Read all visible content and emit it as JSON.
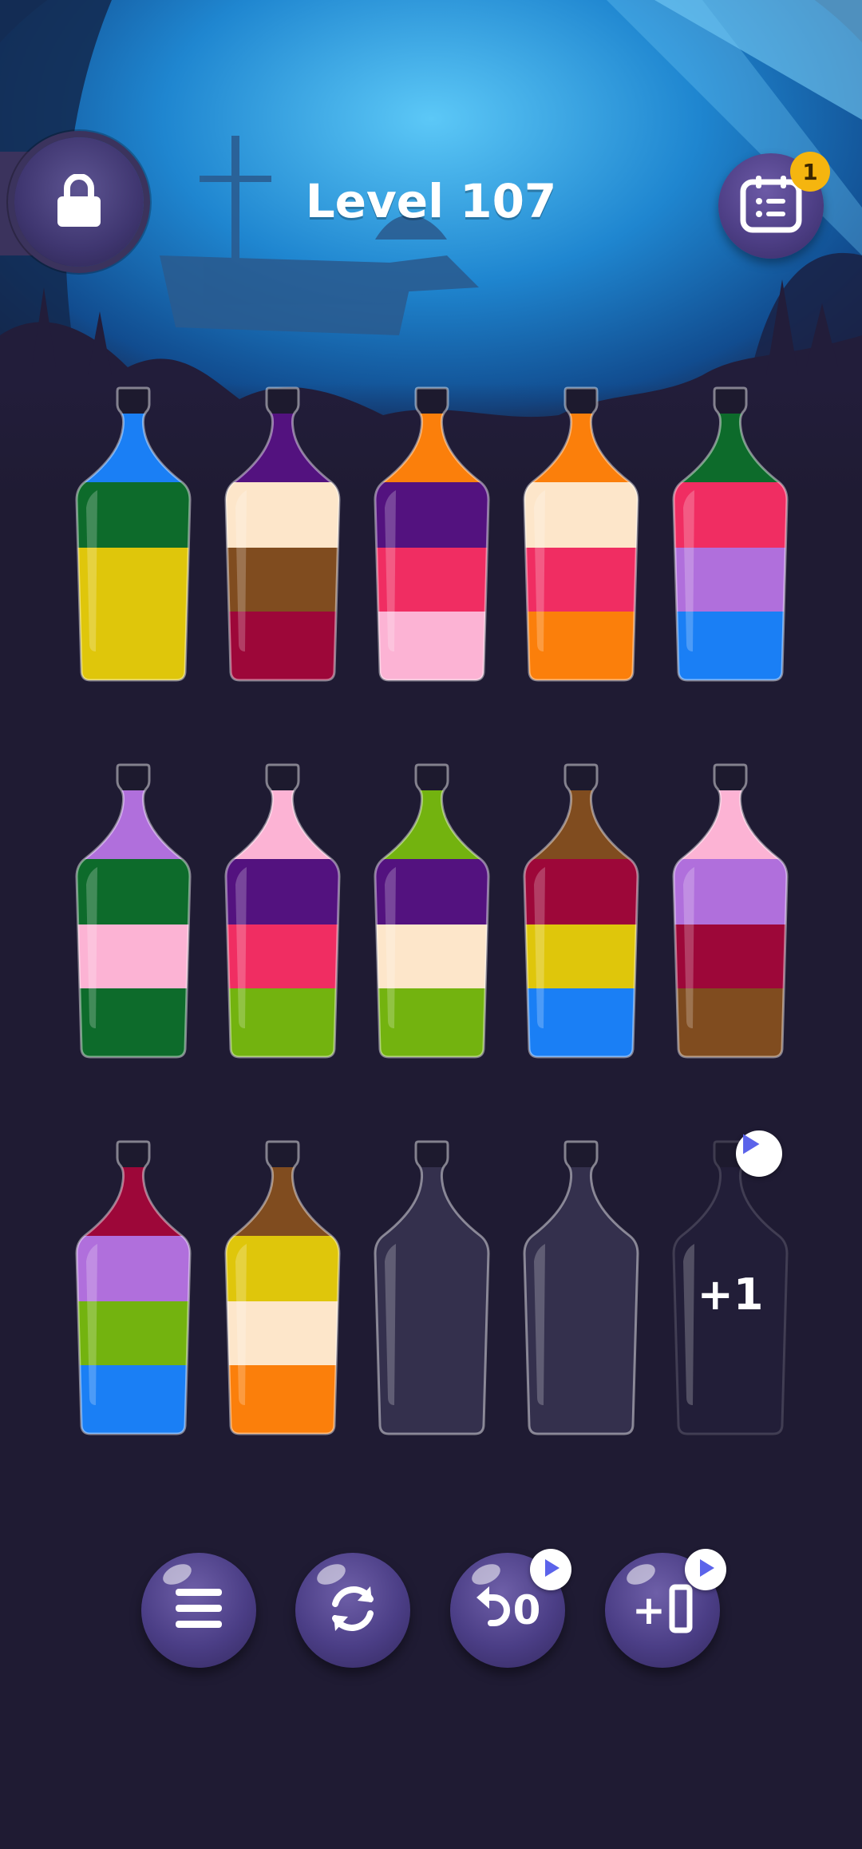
{
  "header": {
    "level_label": "Level 107",
    "lock_icon": "lock-icon",
    "calendar_icon": "calendar-list-icon",
    "notification_count": "1"
  },
  "colors": {
    "blue": "#1a7ff5",
    "green": "#0d6b2b",
    "yellow": "#dfc60b",
    "purple": "#53127f",
    "cream": "#fde6ca",
    "brown": "#804c1f",
    "crimson": "#9d0739",
    "orange": "#fb7f0b",
    "pink": "#f02d62",
    "light_pink": "#fcb3d4",
    "lavender": "#b06fdc",
    "lime": "#73b30f"
  },
  "bottles": [
    {
      "layers": [
        "blue",
        "green",
        "yellow",
        "yellow"
      ]
    },
    {
      "layers": [
        "purple",
        "cream",
        "brown",
        "crimson"
      ]
    },
    {
      "layers": [
        "orange",
        "purple",
        "pink",
        "light_pink"
      ]
    },
    {
      "layers": [
        "orange",
        "cream",
        "pink",
        "orange"
      ]
    },
    {
      "layers": [
        "green",
        "pink",
        "lavender",
        "blue"
      ]
    },
    {
      "layers": [
        "lavender",
        "green",
        "light_pink",
        "green"
      ]
    },
    {
      "layers": [
        "light_pink",
        "purple",
        "pink",
        "lime"
      ]
    },
    {
      "layers": [
        "lime",
        "purple",
        "cream",
        "lime"
      ]
    },
    {
      "layers": [
        "brown",
        "crimson",
        "yellow",
        "blue"
      ]
    },
    {
      "layers": [
        "light_pink",
        "lavender",
        "crimson",
        "brown"
      ]
    },
    {
      "layers": [
        "crimson",
        "lavender",
        "lime",
        "blue"
      ]
    },
    {
      "layers": [
        "brown",
        "yellow",
        "cream",
        "orange"
      ]
    },
    {
      "layers": []
    },
    {
      "layers": []
    },
    {
      "layers": [],
      "locked": true,
      "label": "+1",
      "badge_icon": "video-play-icon"
    }
  ],
  "toolbar": {
    "menu_icon": "menu-icon",
    "restart_icon": "restart-icon",
    "undo_icon": "undo-icon",
    "undo_count": "0",
    "add_bottle_label": "+",
    "add_bottle_icon": "add-bottle-icon",
    "ad_badge_icon": "video-play-icon"
  }
}
